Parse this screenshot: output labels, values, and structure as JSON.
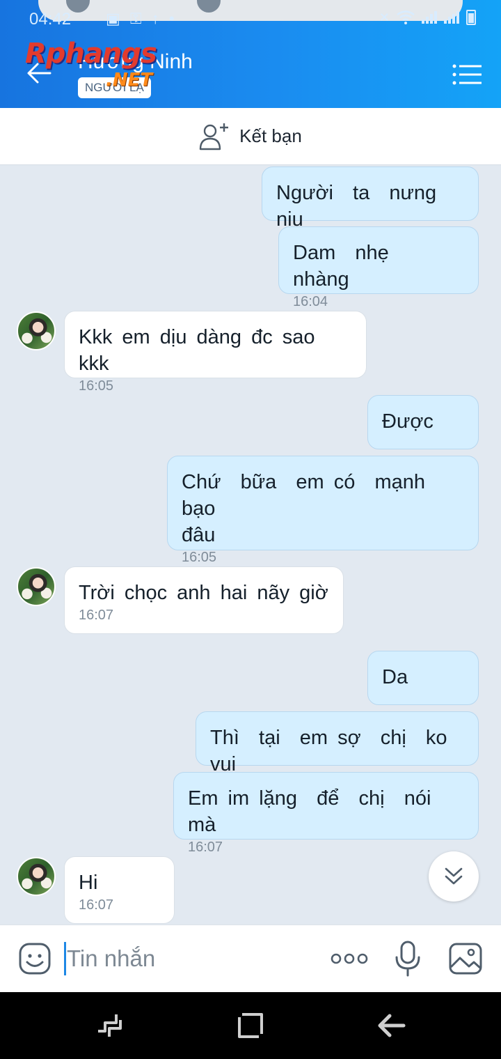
{
  "status_bar": {
    "time": "04:42",
    "icons": [
      "wifi-icon",
      "signal-icon",
      "battery-icon"
    ]
  },
  "header": {
    "contact_name": "Hương Ninh",
    "badge": "NGƯỜI LẠ",
    "back_icon": "arrow-left-icon",
    "menu_icon": "menu-icon"
  },
  "watermark": {
    "primary": "Rphangs",
    "secondary": ".NET"
  },
  "friend_bar": {
    "label": "Kết bạn",
    "icon": "add-user-icon"
  },
  "messages": [
    {
      "direction": "out",
      "text": "Người  ta  nưng niu",
      "time": ""
    },
    {
      "direction": "out",
      "text": "Dam  nhẹ  nhàng",
      "time": "16:04"
    },
    {
      "direction": "in",
      "text": "Kkk em dịu dàng đc sao kkk",
      "time": "16:05"
    },
    {
      "direction": "out",
      "text": "Được",
      "time": ""
    },
    {
      "direction": "out",
      "text": "Chứ  bữa  em có  mạnh bạo\nđâu",
      "time": "16:05"
    },
    {
      "direction": "in",
      "text": "Trời chọc anh hai nãy giờ",
      "time": "16:07"
    },
    {
      "direction": "out",
      "text": "Da",
      "time": ""
    },
    {
      "direction": "out",
      "text": "Thì  tại  em sợ  chị  ko  vui",
      "time": ""
    },
    {
      "direction": "out",
      "text": "Em im lặng  để  chị  nói  mà",
      "time": "16:07"
    },
    {
      "direction": "in",
      "text": "Hi",
      "time": "16:07"
    }
  ],
  "composer": {
    "placeholder": "Tin nhắn",
    "value": ""
  },
  "colors": {
    "header_start": "#1774df",
    "header_end": "#14a3f7",
    "outgoing_bubble": "#d5efff",
    "incoming_bubble": "#ffffff",
    "chat_background": "#e2e9f1"
  }
}
